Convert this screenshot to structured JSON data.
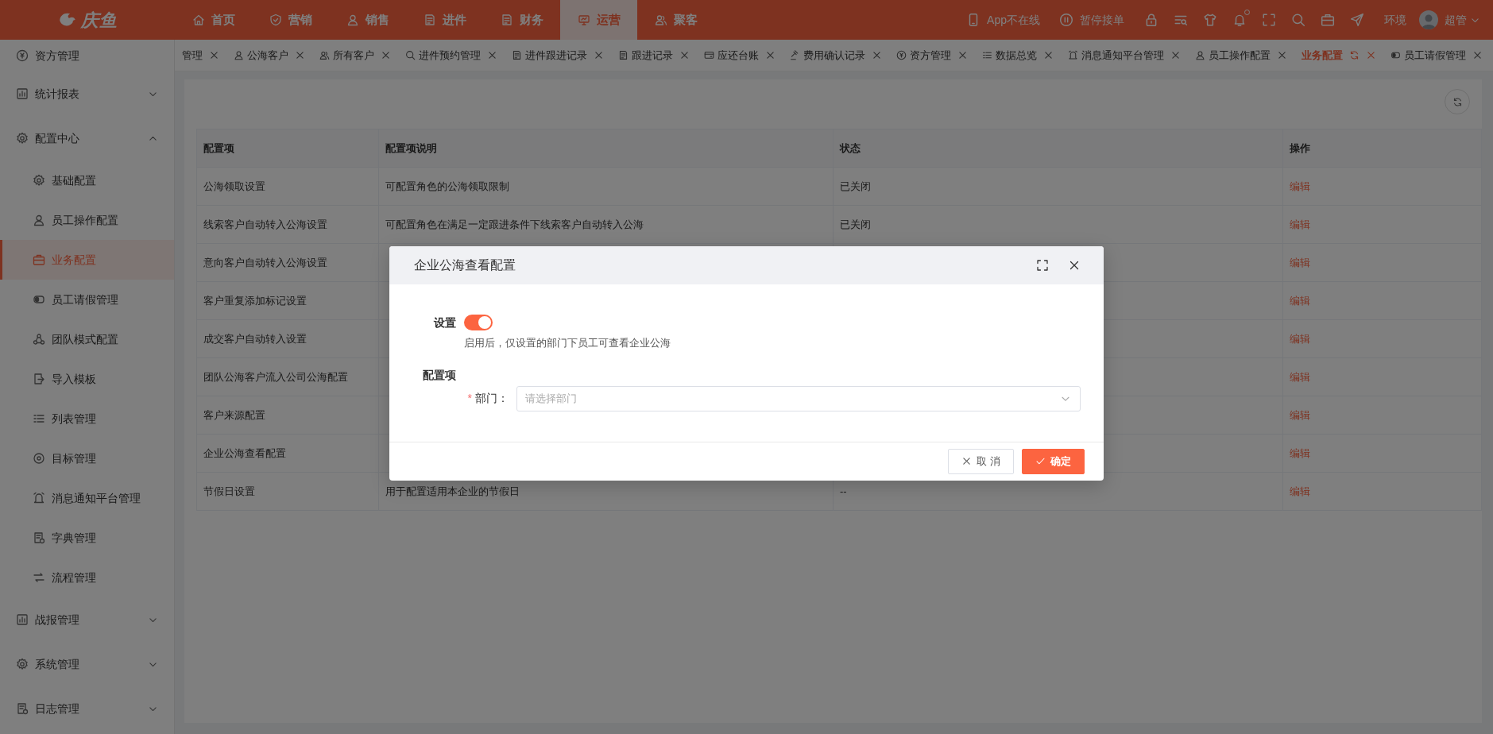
{
  "top_nav": {
    "logo": "庆鱼",
    "items": [
      {
        "label": "首页",
        "selected": false
      },
      {
        "label": "营销",
        "selected": false
      },
      {
        "label": "销售",
        "selected": false
      },
      {
        "label": "进件",
        "selected": false
      },
      {
        "label": "财务",
        "selected": false
      },
      {
        "label": "运营",
        "selected": true
      },
      {
        "label": "聚客",
        "selected": false
      }
    ],
    "status_items": [
      {
        "label": "App不在线"
      },
      {
        "label": "暂停接单"
      }
    ],
    "notification_dot": true,
    "env": "环境",
    "user": "超管"
  },
  "tabs": [
    {
      "label": "管理",
      "selected": false
    },
    {
      "label": "公海客户",
      "selected": false
    },
    {
      "label": "所有客户",
      "selected": false
    },
    {
      "label": "进件预约管理",
      "selected": false
    },
    {
      "label": "进件跟进记录",
      "selected": false
    },
    {
      "label": "跟进记录",
      "selected": false
    },
    {
      "label": "应还台账",
      "selected": false
    },
    {
      "label": "费用确认记录",
      "selected": false
    },
    {
      "label": "资方管理",
      "selected": false
    },
    {
      "label": "数据总览",
      "selected": false
    },
    {
      "label": "消息通知平台管理",
      "selected": false
    },
    {
      "label": "员工操作配置",
      "selected": false
    },
    {
      "label": "业务配置",
      "selected": true
    },
    {
      "label": "员工请假管理",
      "selected": false
    }
  ],
  "sidebar": {
    "items": [
      {
        "label": "资方管理",
        "kind": "link",
        "selected": false
      },
      {
        "label": "统计报表",
        "kind": "group",
        "selected": false,
        "expanded": false
      },
      {
        "label": "配置中心",
        "kind": "group",
        "selected": false,
        "expanded": true,
        "children": [
          {
            "label": "基础配置",
            "selected": false
          },
          {
            "label": "员工操作配置",
            "selected": false
          },
          {
            "label": "业务配置",
            "selected": true
          },
          {
            "label": "员工请假管理",
            "selected": false
          },
          {
            "label": "团队模式配置",
            "selected": false
          },
          {
            "label": "导入模板",
            "selected": false
          },
          {
            "label": "列表管理",
            "selected": false
          },
          {
            "label": "目标管理",
            "selected": false
          },
          {
            "label": "消息通知平台管理",
            "selected": false
          },
          {
            "label": "字典管理",
            "selected": false
          },
          {
            "label": "流程管理",
            "selected": false
          }
        ]
      },
      {
        "label": "战报管理",
        "kind": "group",
        "selected": false,
        "expanded": false
      },
      {
        "label": "系统管理",
        "kind": "group",
        "selected": false,
        "expanded": false
      },
      {
        "label": "日志管理",
        "kind": "group",
        "selected": false,
        "expanded": false
      }
    ]
  },
  "table": {
    "columns": [
      "配置项",
      "配置项说明",
      "状态",
      "操作"
    ],
    "rows": [
      {
        "name": "公海领取设置",
        "description": "可配置角色的公海领取限制",
        "status": "已关闭",
        "action": "编辑"
      },
      {
        "name": "线索客户自动转入公海设置",
        "description": "可配置角色在满足一定跟进条件下线索客户自动转入公海",
        "status": "已关闭",
        "action": "编辑"
      },
      {
        "name": "意向客户自动转入公海设置",
        "action": "编辑"
      },
      {
        "name": "客户重复添加标记设置",
        "action": "编辑"
      },
      {
        "name": "成交客户自动转入设置",
        "action": "编辑"
      },
      {
        "name": "团队公海客户流入公司公海配置",
        "action": "编辑"
      },
      {
        "name": "客户来源配置",
        "action": "编辑"
      },
      {
        "name": "企业公海查看配置",
        "action": "编辑"
      },
      {
        "name": "节假日设置",
        "description": "用于配置适用本企业的节假日",
        "status": "--",
        "action": "编辑"
      }
    ]
  },
  "dialog": {
    "title": "企业公海查看配置",
    "switch": {
      "label": "设置",
      "on": true
    },
    "hint": "启用后，仅设置的部门下员工可查看企业公海",
    "section": "配置项",
    "fields": [
      {
        "required_mark": "*",
        "label": "部门：",
        "placeholder": "请选择部门"
      }
    ],
    "buttons": [
      {
        "label": "取 消",
        "kind": "default"
      },
      {
        "label": "确定",
        "kind": "primary"
      }
    ]
  }
}
